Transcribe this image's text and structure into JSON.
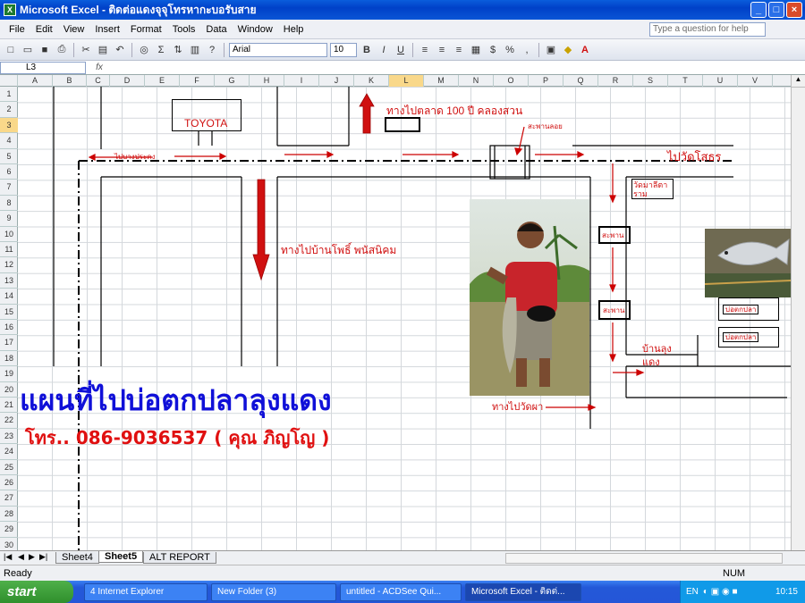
{
  "window": {
    "title": "Microsoft Excel - ติดต่อแดงจุจุโทรหากะบอรับสาย",
    "min": "_",
    "max": "□",
    "close": "×"
  },
  "menu": [
    "File",
    "Edit",
    "View",
    "Insert",
    "Format",
    "Tools",
    "Data",
    "Window",
    "Help"
  ],
  "help_placeholder": "Type a question for help",
  "toolbar": {
    "font": "Arial",
    "size": "10",
    "bold": "B",
    "italic": "I",
    "underline": "U",
    "percent": "%",
    "comma": ","
  },
  "formula": {
    "cell_ref": "L3",
    "fx": "fx",
    "content": ""
  },
  "columns": [
    "A",
    "B",
    "C",
    "D",
    "E",
    "F",
    "G",
    "H",
    "I",
    "J",
    "K",
    "L",
    "M",
    "N",
    "O",
    "P",
    "Q",
    "R",
    "S",
    "T",
    "U",
    "V"
  ],
  "rows": [
    "1",
    "2",
    "3",
    "4",
    "5",
    "6",
    "7",
    "8",
    "9",
    "10",
    "11",
    "12",
    "13",
    "14",
    "15",
    "16",
    "17",
    "18",
    "19",
    "20",
    "21",
    "22",
    "23",
    "24",
    "25",
    "26",
    "27",
    "28",
    "29",
    "30"
  ],
  "map": {
    "toyota": "TOYOTA",
    "left_road": "ไปบางประคง",
    "to_market": "ทางไปตลาด  100  ปี คลองสวน",
    "bridge_label": "สะพานลอย",
    "to_temple_right": "ไปวัดโสธร",
    "to_pho_phanit": "ทางไปบ้านโพธิ์  พนัสนิคม",
    "temple_box": "วัดมาลีตาราม",
    "bridge1": "สะพาน",
    "bridge2": "สะพาน",
    "pond1": "บ่อตกปลา",
    "pond2": "บ่อตกปลา",
    "uncle_house": "บ้านลุงแดง",
    "to_temple_bottom": "ทางไปวัดผา"
  },
  "headline": "แผนที่ไปบ่อตกปลาลุงแดง",
  "phone_line": "โทร..  086-9036537  (  คุณ  ภิญโญ  )",
  "sheet_tabs": [
    "Sheet4",
    "Sheet5",
    "ALT  REPORT"
  ],
  "active_sheet": "Sheet5",
  "status": {
    "left": "Ready",
    "num": "NUM"
  },
  "taskbar": {
    "start": "start",
    "items": [
      "4 Internet Explorer",
      "New Folder (3)",
      "untitled - ACDSee Qui...",
      "Microsoft Excel - ติดต่..."
    ],
    "lang": "EN",
    "clock": "10:15"
  }
}
